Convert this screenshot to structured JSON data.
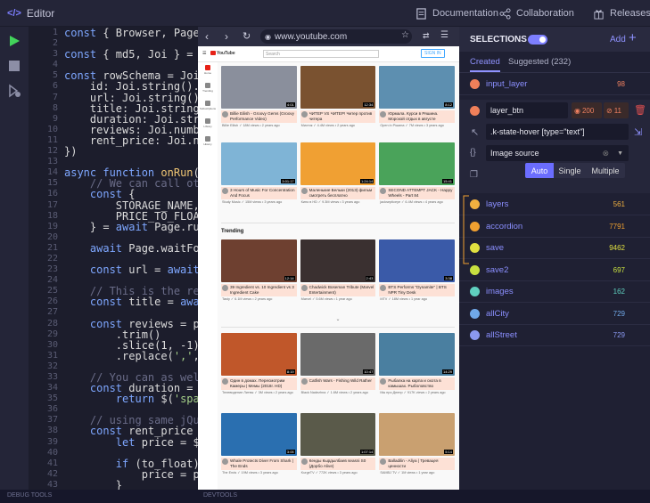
{
  "app": {
    "tab_label": "Editor",
    "tab_icon": "</>",
    "nav": {
      "documentation": "Documentation",
      "collaboration": "Collaboration",
      "releases": "Releases"
    }
  },
  "code": {
    "line_numbers": [
      "1",
      "2",
      "3",
      "4",
      "5",
      "6",
      "7",
      "8",
      "9",
      "10",
      "11",
      "12",
      "13",
      "14",
      "15",
      "16",
      "17",
      "18",
      "19",
      "20",
      "21",
      "22",
      "23",
      "24",
      "25",
      "26",
      "27",
      "28",
      "29",
      "30",
      "31",
      "32",
      "33",
      "34",
      "35",
      "36",
      "37",
      "38",
      "39",
      "40",
      "41",
      "42",
      "43"
    ],
    "lines": [
      "const { Browser, Page, Que",
      "",
      "const { md5, Joi } = Utils",
      "",
      "const rowSchema = Joi.obje",
      "    id: Joi.string().requi",
      "    url: Joi.string().uri(",
      "    title: Joi.string().re",
      "    duration: Joi.string()",
      "    reviews: Joi.number().",
      "    rent_price: Joi.number",
      "})",
      "",
      "async function onRun(args,",
      "    // We can call other t",
      "    const {",
      "        STORAGE_NAME,",
      "        PRICE_TO_FLOAT",
      "    } = await Page.runTask",
      "",
      "    await Page.waitFor(thi",
      "",
      "    const url = await Page",
      "",
      "    // This is the regular",
      "    const title = await th",
      "",
      "    const reviews = parseI",
      "        .trim()",
      "        .slice(1, -1)",
      "        .replace(',', ''))",
      "",
      "    // You can as well use",
      "    const duration = await",
      "        return $('span:con",
      "",
      "    // using same jQuery a",
      "    const rent_price = awa",
      "        let price = $('div",
      "",
      "        if (to_float) {",
      "            price = parseF",
      "        }",
      "        return price || 0"
    ]
  },
  "browser": {
    "url": "www.youtube.com",
    "logo": "YouTube",
    "search_placeholder": "Search",
    "sign_in": "SIGN IN",
    "sidebar": [
      "Home",
      "Trending",
      "Subscriptions",
      "Library",
      "History"
    ],
    "section_trending": "Trending",
    "row1": [
      {
        "title": "Billie Eilish - Groovy Gems (Groovy Performance Video)",
        "meta": "Billie Eilish ✓ 18M views • 2 years ago",
        "dur": "4:01",
        "color": "#8a8f9c"
      },
      {
        "title": "ЧИТЕР VS ЧИТЕР! Читер против читера",
        "meta": "Мистик ✓ 4.4M views • 2 years ago",
        "dur": "12:34",
        "color": "#7a5230"
      },
      {
        "title": "Юрмала. Курси в Ряшина. Морской отдых в августе",
        "meta": "Open in Рішина ✓ 7M views • 3 years ago",
        "dur": "8:12",
        "color": "#5d8fb0"
      }
    ],
    "row2": [
      {
        "title": "3 Hours of Music For Concentration And Focus",
        "meta": "Study Music ✓ 15M views • 3 years ago",
        "dur": "3:01:17",
        "color": "#7fb4d6"
      },
      {
        "title": "Маленькие Бельки (2013) фильм смотреть бесплатно",
        "meta": "Кино в HD ✓ 9.3M views • 3 years ago",
        "dur": "1:24:14",
        "color": "#f0a033"
      },
      {
        "title": "SECOND ATTEMPT JACK - Happy Wheels - Part 84",
        "meta": "jacksepticeye ✓ 6.4M views • 4 years ago",
        "dur": "15:41",
        "color": "#4aa35a"
      }
    ],
    "row3": [
      {
        "title": "39 Ingredient vs. 10 Ingredient vs 3 Ingredient Cake",
        "meta": "Tasty ✓ 6.1M views • 2 years ago",
        "dur": "12:14",
        "color": "#6e4030"
      },
      {
        "title": "Chadwick Boseman Tribute (Marvel Entertainment)",
        "meta": "Marvel ✓ 5.6M views • 1 year ago",
        "dur": "2:43",
        "color": "#3a3030"
      },
      {
        "title": "BTS Performs \"Dynamite\" | BTS NPR Tiny Desk",
        "meta": "MTV ✓ 18M views • 1 year ago",
        "dur": "3:38",
        "color": "#3a5aa8"
      }
    ],
    "row4": [
      {
        "title": "Один в домах. Пересмотрим Камеры | Мемы (2018г. HD)",
        "meta": "Телевидение Литвы ✓ 3M views • 2 years ago",
        "dur": "8:19",
        "color": "#c0572a"
      },
      {
        "title": "Catfish Wars - Fishing Wild Rather",
        "meta": "Black Nadezhna ✓ 1.6M views • 2 years ago",
        "dur": "10:47",
        "color": "#6a6a6a"
      },
      {
        "title": "Рыбалка на карпа и охота в камышах. Рыболовство",
        "meta": "Мы про Днепр ✓ 917K views • 2 years ago",
        "dur": "14:29",
        "color": "#4a7fa0"
      }
    ],
    "row5": [
      {
        "title": "Whale Protects Diver From Shark | The Ends",
        "meta": "The Ends ✓ 19M views • 3 years ago",
        "dur": "3:05",
        "color": "#2a6fb0"
      },
      {
        "title": "Кенды Кырдылбаев seasni S0 (Дорбо Alive)",
        "meta": "KurgeTV ✓ 772K views • 3 years ago",
        "dur": "1:07:14",
        "color": "#5a5a4a"
      },
      {
        "title": "Balladilin - Aliya | Тревацея ценности",
        "meta": "SAMBJ TV ✓ 1M views • 1 year ago",
        "dur": "5:14",
        "color": "#c9a070"
      }
    ]
  },
  "bottom": {
    "debug": "DEBUG TOOLS",
    "devtools": "DEVTOOLS"
  },
  "selections": {
    "title": "SELECTIONS",
    "add": "Add",
    "tabs": {
      "created": "Created",
      "suggested": "Suggested (232)"
    },
    "top": {
      "name": "input_layer",
      "count": "98",
      "color": "#f0805a"
    },
    "edit": {
      "name": "layer_btn",
      "visible_count": "200",
      "hidden_count": "11",
      "selector": ".k-state-hover [type=\"text\"]",
      "source": "Image source",
      "modes": [
        "Auto",
        "Single",
        "Multiple"
      ],
      "active_mode": "Auto"
    },
    "items": [
      {
        "name": "layers",
        "count": "561",
        "color": "#f0b040"
      },
      {
        "name": "accordion",
        "count": "7791",
        "color": "#f0a030"
      },
      {
        "name": "save",
        "count": "9462",
        "color": "#e0e040"
      },
      {
        "name": "save2",
        "count": "697",
        "color": "#c8e040"
      },
      {
        "name": "images",
        "count": "162",
        "color": "#60d0c0"
      },
      {
        "name": "allCity",
        "count": "729",
        "color": "#70a8e8"
      },
      {
        "name": "allStreet",
        "count": "729",
        "color": "#8a98f0"
      }
    ]
  }
}
